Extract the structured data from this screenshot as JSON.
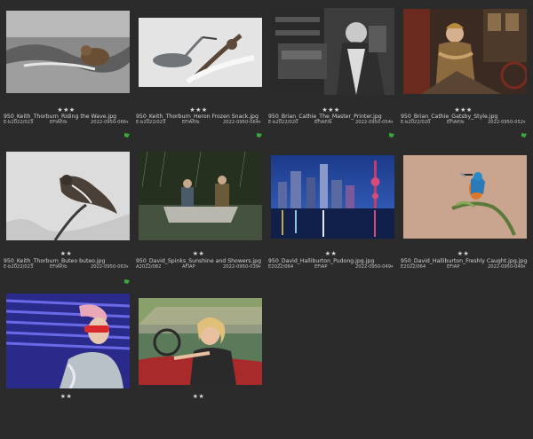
{
  "colors": {
    "background": "#2b2b2b",
    "text": "#cfcfcf",
    "flag": "#3aa83a"
  },
  "thumbnails": [
    {
      "stars": "★★★",
      "filename": "950_Keith_Thorburn_Riding the Wave.jpg",
      "code1": "E-b2022/023",
      "code2": "EFIAP/b",
      "code3": "2022-0950-066"
    },
    {
      "stars": "★★★",
      "filename": "950_Keith_Thorburn_Heron Frozen Snack.jpg",
      "code1": "E-b2022/023",
      "code2": "EFIAP/b",
      "code3": "2022-0950-064"
    },
    {
      "stars": "★★★",
      "filename": "950_Brian_Cathie_The_Master_Printer.jpg",
      "code1": "E-b2022/020",
      "code2": "EFIAP/b",
      "code3": "2022-0950-054"
    },
    {
      "stars": "★★★",
      "filename": "950_Brian_Cathie_Gatsby_Style.jpg",
      "code1": "E-b2022/020",
      "code2": "EFIAP/b",
      "code3": "2022-0950-052"
    },
    {
      "stars": "★★",
      "filename": "950_Keith_Thorburn_Buteo buteo.jpg",
      "code1": "E-b2022/023",
      "code2": "EFIAP/b",
      "code3": "2022-0950-063"
    },
    {
      "stars": "★★",
      "filename": "950_David_Spinks_Sunshine and Showers.jpg",
      "code1": "A2022/082",
      "code2": "AFIAP",
      "code3": "2022-0950-039"
    },
    {
      "stars": "★★",
      "filename": "950_David_Halliburton_Pudong.jpg.jpg",
      "code1": "E2022/064",
      "code2": "EFIAP",
      "code3": "2022-0950-049"
    },
    {
      "stars": "★★",
      "filename": "950_David_Halliburton_Freshly Caught.jpg.jpg",
      "code1": "E2022/064",
      "code2": "EFIAP",
      "code3": "2022-0950-048"
    },
    {
      "stars": "★★",
      "filename": "",
      "code1": "",
      "code2": "",
      "code3": ""
    },
    {
      "stars": "★★",
      "filename": "",
      "code1": "",
      "code2": "",
      "code3": ""
    }
  ]
}
